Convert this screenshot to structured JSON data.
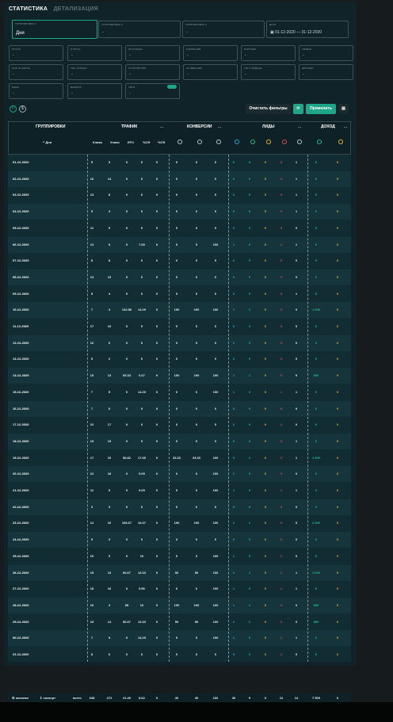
{
  "tabs": [
    {
      "label": "СТАТИСТИКА"
    },
    {
      "label": "ДЕТАЛИЗАЦИЯ"
    }
  ],
  "filters": {
    "group": {
      "label": "ГРУППИРОВКА 1",
      "value": "Дни"
    },
    "group2": {
      "label": "ГРУППИРОВКА 2",
      "value": "-"
    },
    "group3": {
      "label": "ГРУППИРОВКА 3",
      "value": "-"
    },
    "date": {
      "label": "ДАТА",
      "value": "01-12-2020 — 31-12-2020"
    },
    "row2": [
      {
        "label": "ПОТОК",
        "value": "-"
      },
      {
        "label": "СТАТУС",
        "value": "-"
      },
      {
        "label": "ИСТОЧНИК",
        "value": "-"
      },
      {
        "label": "КАМПАНИЯ",
        "value": "-"
      },
      {
        "label": "ПАРТНЕР",
        "value": "-"
      },
      {
        "label": "ОФФЕР",
        "value": "-"
      }
    ],
    "row3": [
      {
        "label": "SUB ID МЕТКА",
        "value": "-"
      },
      {
        "label": "ГЕО СТРАНА",
        "value": "-"
      },
      {
        "label": "УСТРОЙСТВО",
        "value": "-"
      },
      {
        "label": "ОС ВЕРСИЯ",
        "value": "-"
      },
      {
        "label": "ТИП ТРАФИКА",
        "value": "-"
      },
      {
        "label": "БРАУЗЕР",
        "value": "-"
      }
    ],
    "row4": [
      {
        "label": "ЯЗЫК",
        "value": "-"
      },
      {
        "label": "ВАЛЮТА",
        "value": "-"
      },
      {
        "label": "ТЕГИ",
        "value": "-"
      }
    ]
  },
  "toolbar": {
    "clear_label": "Очистить фильтры",
    "apply_label": "Применить"
  },
  "groups": {
    "grouping": "ГРУППИРОВКИ",
    "traffic": "ТРАФИК",
    "conversions": "КОНВЕРСИИ",
    "leads": "ЛИДЫ",
    "income": "ДОХОД",
    "more": "..."
  },
  "columns": {
    "day": "^ Дни",
    "clicks": "Клики",
    "uniq": "Уники",
    "epc": "EPC",
    "scr": "%CR",
    "bcr": "%CR"
  },
  "colors": {
    "accent": "#1fa588",
    "cyan": "#29a9d4",
    "green": "#1dbd8a",
    "yellow": "#e5b42c",
    "red": "#e14b4b",
    "orange": "#e58d2c"
  },
  "rows": [
    [
      "01-12-2020",
      "5",
      "5",
      "0",
      "0",
      "0",
      "0",
      "0",
      "0",
      "0",
      "0",
      "0",
      "0",
      "1",
      "0",
      "0"
    ],
    [
      "02-12-2020",
      "16",
      "14",
      "0",
      "0",
      "0",
      "0",
      "0",
      "0",
      "0",
      "0",
      "0",
      "0",
      "1",
      "0",
      "0"
    ],
    [
      "03-12-2020",
      "13",
      "8",
      "0",
      "0",
      "0",
      "0",
      "0",
      "0",
      "0",
      "0",
      "0",
      "0",
      "1",
      "0",
      "0"
    ],
    [
      "04-12-2020",
      "5",
      "4",
      "0",
      "0",
      "0",
      "0",
      "0",
      "0",
      "0",
      "0",
      "0",
      "0",
      "1",
      "0",
      "0"
    ],
    [
      "05-12-2020",
      "11",
      "9",
      "0",
      "0",
      "0",
      "0",
      "0",
      "0",
      "0",
      "0",
      "0",
      "0",
      "0",
      "0",
      "0"
    ],
    [
      "06-12-2020",
      "13",
      "5",
      "0",
      "7.69",
      "0",
      "0",
      "0",
      "100",
      "1",
      "0",
      "0",
      "1",
      "1",
      "0",
      "0"
    ],
    [
      "07-12-2020",
      "8",
      "8",
      "0",
      "0",
      "0",
      "0",
      "0",
      "0",
      "0",
      "0",
      "0",
      "0",
      "0",
      "0",
      "0"
    ],
    [
      "08-12-2020",
      "14",
      "13",
      "0",
      "0",
      "0",
      "0",
      "0",
      "0",
      "0",
      "0",
      "0",
      "0",
      "0",
      "0",
      "0"
    ],
    [
      "09-12-2020",
      "5",
      "4",
      "0",
      "0",
      "0",
      "0",
      "0",
      "0",
      "0",
      "0",
      "0",
      "0",
      "1",
      "0",
      "0"
    ],
    [
      "10-12-2020",
      "7",
      "4",
      "142.86",
      "14.29",
      "0",
      "100",
      "100",
      "100",
      "1",
      "1",
      "0",
      "0",
      "0",
      "1 000",
      "0"
    ],
    [
      "11-12-2020",
      "17",
      "16",
      "0",
      "0",
      "0",
      "0",
      "0",
      "0",
      "0",
      "0",
      "0",
      "0",
      "0",
      "0",
      "0"
    ],
    [
      "12-12-2020",
      "10",
      "6",
      "0",
      "0",
      "0",
      "0",
      "0",
      "0",
      "0",
      "0",
      "0",
      "0",
      "0",
      "0",
      "0"
    ],
    [
      "13-12-2020",
      "5",
      "2",
      "0",
      "0",
      "0",
      "0",
      "0",
      "0",
      "0",
      "0",
      "0",
      "0",
      "0",
      "0",
      "0"
    ],
    [
      "14-12-2020",
      "15",
      "13",
      "53.33",
      "6.67",
      "0",
      "100",
      "100",
      "100",
      "1",
      "1",
      "0",
      "0",
      "0",
      "800",
      "0"
    ],
    [
      "15-12-2020",
      "7",
      "5",
      "0",
      "14.29",
      "0",
      "0",
      "0",
      "100",
      "1",
      "0",
      "0",
      "1",
      "1",
      "0",
      "0"
    ],
    [
      "16-12-2020",
      "7",
      "6",
      "0",
      "0",
      "0",
      "0",
      "0",
      "0",
      "0",
      "0",
      "0",
      "0",
      "0",
      "0",
      "0"
    ],
    [
      "17-12-2020",
      "22",
      "17",
      "0",
      "0",
      "0",
      "0",
      "0",
      "0",
      "0",
      "0",
      "0",
      "1",
      "0",
      "0",
      "0"
    ],
    [
      "18-12-2020",
      "15",
      "15",
      "0",
      "0",
      "0",
      "0",
      "0",
      "0",
      "0",
      "0",
      "0",
      "0",
      "1",
      "0",
      "0"
    ],
    [
      "19-12-2020",
      "17",
      "10",
      "58.82",
      "17.65",
      "0",
      "33.33",
      "33.33",
      "100",
      "3",
      "1",
      "0",
      "2",
      "1",
      "1 000",
      "0"
    ],
    [
      "20-12-2020",
      "22",
      "18",
      "0",
      "9.09",
      "0",
      "0",
      "0",
      "100",
      "2",
      "0",
      "0",
      "2",
      "0",
      "0",
      "0"
    ],
    [
      "21-12-2020",
      "11",
      "9",
      "0",
      "9.09",
      "0",
      "0",
      "0",
      "100",
      "1",
      "0",
      "0",
      "1",
      "1",
      "0",
      "0"
    ],
    [
      "22-12-2020",
      "3",
      "3",
      "0",
      "0",
      "0",
      "0",
      "0",
      "0",
      "0",
      "0",
      "0",
      "0",
      "0",
      "0",
      "0"
    ],
    [
      "23-12-2020",
      "12",
      "10",
      "166.67",
      "16.67",
      "0",
      "100",
      "100",
      "100",
      "2",
      "2",
      "0",
      "0",
      "0",
      "2 000",
      "0"
    ],
    [
      "24-12-2020",
      "5",
      "3",
      "0",
      "0",
      "0",
      "0",
      "0",
      "0",
      "0",
      "0",
      "0",
      "0",
      "0",
      "0",
      "0"
    ],
    [
      "25-12-2020",
      "10",
      "9",
      "0",
      "10",
      "0",
      "0",
      "0",
      "100",
      "1",
      "0",
      "0",
      "1",
      "0",
      "0",
      "0"
    ],
    [
      "26-12-2020",
      "15",
      "13",
      "66.67",
      "13.33",
      "0",
      "50",
      "50",
      "100",
      "2",
      "1",
      "0",
      "1",
      "1",
      "1 000",
      "0"
    ],
    [
      "27-12-2020",
      "18",
      "16",
      "0",
      "5.56",
      "0",
      "0",
      "0",
      "100",
      "1",
      "0",
      "0",
      "1",
      "1",
      "0",
      "0"
    ],
    [
      "28-12-2020",
      "10",
      "4",
      "85",
      "10",
      "0",
      "100",
      "100",
      "100",
      "1",
      "1",
      "0",
      "0",
      "0",
      "850",
      "0"
    ],
    [
      "29-12-2020",
      "15",
      "14",
      "56.67",
      "13.33",
      "0",
      "50",
      "50",
      "100",
      "2",
      "1",
      "0",
      "1",
      "0",
      "850",
      "0"
    ],
    [
      "30-12-2020",
      "7",
      "5",
      "0",
      "14.29",
      "0",
      "0",
      "0",
      "100",
      "1",
      "0",
      "0",
      "1",
      "1",
      "0",
      "0"
    ],
    [
      "31-12-2020",
      "8",
      "6",
      "0",
      "0",
      "0",
      "0",
      "0",
      "0",
      "0",
      "0",
      "0",
      "1",
      "0",
      "0",
      "0"
    ]
  ],
  "footer": {
    "columns_label": "колонки",
    "export_label": "экспорт",
    "total_label": "всего",
    "values": [
      "348",
      "272",
      "21.49",
      "8.62",
      "0",
      "40",
      "40",
      "100",
      "30",
      "9",
      "0",
      "12",
      "14",
      "7 500",
      "0"
    ]
  }
}
